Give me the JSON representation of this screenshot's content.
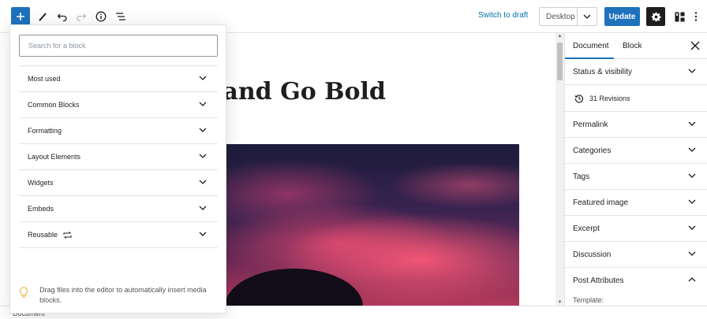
{
  "topbar": {
    "switch_draft": "Switch to draft",
    "preview_device": "Desktop",
    "update": "Update"
  },
  "editor": {
    "title_visible": "g and Go Bold"
  },
  "sidebar": {
    "tabs": [
      {
        "label": "Document",
        "active": true
      },
      {
        "label": "Block",
        "active": false
      }
    ],
    "panels": [
      {
        "label": "Status & visibility",
        "expanded": false
      },
      {
        "label": "Permalink",
        "expanded": false
      },
      {
        "label": "Categories",
        "expanded": false
      },
      {
        "label": "Tags",
        "expanded": false
      },
      {
        "label": "Featured image",
        "expanded": false
      },
      {
        "label": "Excerpt",
        "expanded": false
      },
      {
        "label": "Discussion",
        "expanded": false
      },
      {
        "label": "Post Attributes",
        "expanded": true
      }
    ],
    "revisions": "31 Revisions",
    "template_label": "Template:"
  },
  "inserter": {
    "search_placeholder": "Search for a block",
    "categories": [
      {
        "label": "Most used"
      },
      {
        "label": "Common Blocks"
      },
      {
        "label": "Formatting"
      },
      {
        "label": "Layout Elements"
      },
      {
        "label": "Widgets"
      },
      {
        "label": "Embeds"
      },
      {
        "label": "Reusable"
      }
    ],
    "tip": "Drag files into the editor to automatically insert media blocks."
  },
  "status_bar": {
    "breadcrumb": "Document"
  },
  "colors": {
    "accent": "#1e72bd",
    "link": "#0073aa",
    "tip_bulb": "#f0b849"
  }
}
